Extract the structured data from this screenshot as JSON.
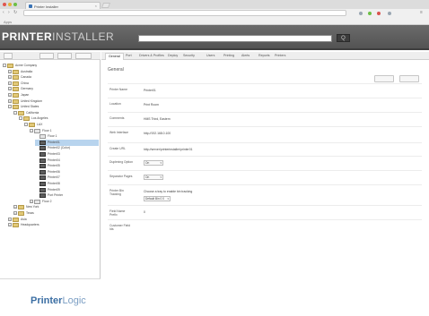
{
  "browser": {
    "tab_title": "Printer Installer",
    "url": "",
    "bookmark": "Apps"
  },
  "header": {
    "logo_main": "PRINTER",
    "logo_sub": "INSTALLER",
    "search_button": "Q",
    "links": [
      "",
      "",
      " "
    ]
  },
  "left_tools": [
    "",
    "",
    ""
  ],
  "tree": [
    {
      "label": "Acme Company",
      "level": 0,
      "icon": "folder",
      "toggle": "-"
    },
    {
      "label": "Australia",
      "level": 1,
      "icon": "folder",
      "toggle": "+"
    },
    {
      "label": "Canada",
      "level": 1,
      "icon": "folder",
      "toggle": "+"
    },
    {
      "label": "China",
      "level": 1,
      "icon": "folder",
      "toggle": "+"
    },
    {
      "label": "Germany",
      "level": 1,
      "icon": "folder",
      "toggle": "+"
    },
    {
      "label": "Japan",
      "level": 1,
      "icon": "folder",
      "toggle": "+"
    },
    {
      "label": "United Kingdom",
      "level": 1,
      "icon": "folder",
      "toggle": "+"
    },
    {
      "label": "United States",
      "level": 1,
      "icon": "folder",
      "toggle": "-"
    },
    {
      "label": "California",
      "level": 2,
      "icon": "folder",
      "toggle": "-"
    },
    {
      "label": "Los Angeles",
      "level": 3,
      "icon": "folder",
      "toggle": "-"
    },
    {
      "label": "LAX",
      "level": 4,
      "icon": "folder",
      "toggle": "-"
    },
    {
      "label": "Floor 1",
      "level": 5,
      "icon": "floor",
      "toggle": "-"
    },
    {
      "label": "Floor 1",
      "level": 6,
      "icon": "floor",
      "toggle": ""
    },
    {
      "label": "Printer01",
      "level": 6,
      "icon": "printer",
      "toggle": "",
      "selected": true
    },
    {
      "label": "Printer02 (Color)",
      "level": 6,
      "icon": "printer",
      "toggle": ""
    },
    {
      "label": "Printer03",
      "level": 6,
      "icon": "printer",
      "toggle": ""
    },
    {
      "label": "Printer04",
      "level": 6,
      "icon": "printer",
      "toggle": ""
    },
    {
      "label": "Printer05",
      "level": 6,
      "icon": "printer",
      "toggle": ""
    },
    {
      "label": "Printer06",
      "level": 6,
      "icon": "printer",
      "toggle": ""
    },
    {
      "label": "Printer07",
      "level": 6,
      "icon": "printer",
      "toggle": ""
    },
    {
      "label": "Printer08",
      "level": 6,
      "icon": "printer",
      "toggle": ""
    },
    {
      "label": "Printer09",
      "level": 6,
      "icon": "printer",
      "toggle": ""
    },
    {
      "label": "Port Printer",
      "level": 6,
      "icon": "printer",
      "toggle": ""
    },
    {
      "label": "Floor 2",
      "level": 5,
      "icon": "floor",
      "toggle": "+"
    },
    {
      "label": "New York",
      "level": 2,
      "icon": "folder",
      "toggle": "+"
    },
    {
      "label": "Texas",
      "level": 2,
      "icon": "folder",
      "toggle": "+"
    },
    {
      "label": "Asia",
      "level": 1,
      "icon": "folder",
      "toggle": "+"
    },
    {
      "label": "Headquarters",
      "level": 1,
      "icon": "folder",
      "toggle": "+"
    }
  ],
  "brand": {
    "bold": "Printer",
    "thin": "Logic"
  },
  "right_tabs": [
    "General",
    "Port",
    "Drivers & Profiles",
    "Deploy",
    "Security",
    "Users",
    "Printing",
    "Alerts",
    "Reports",
    "Printers"
  ],
  "section_title": "General",
  "top_buttons": [
    "",
    ""
  ],
  "form_rows": [
    {
      "label": "Printer Name",
      "value": "Printer01",
      "kind": "text"
    },
    {
      "label": "Location",
      "value": "Print Room",
      "kind": "text"
    },
    {
      "label": "Comments",
      "value": "HMS Third, Eastern",
      "kind": "text"
    },
    {
      "label": "Web Interface",
      "value": "http://192.168.0.100",
      "kind": "text"
    },
    {
      "label": "Create URL",
      "value": "http://server/printerinstaller/printer01",
      "kind": "text"
    },
    {
      "label": "Duplexing Option",
      "value": "On",
      "kind": "select"
    },
    {
      "label": "Separator Pages",
      "value": "On",
      "kind": "select"
    },
    {
      "label": "Printer Bin Tracking",
      "value": "Choose a tray to enable bin tracking",
      "value2": "Default Bin 0 0",
      "kind": "text-select"
    },
    {
      "label": "Field Name Prefix",
      "value": "0",
      "kind": "text"
    },
    {
      "label": "Customer Field Ids",
      "value": "",
      "kind": "text"
    }
  ]
}
